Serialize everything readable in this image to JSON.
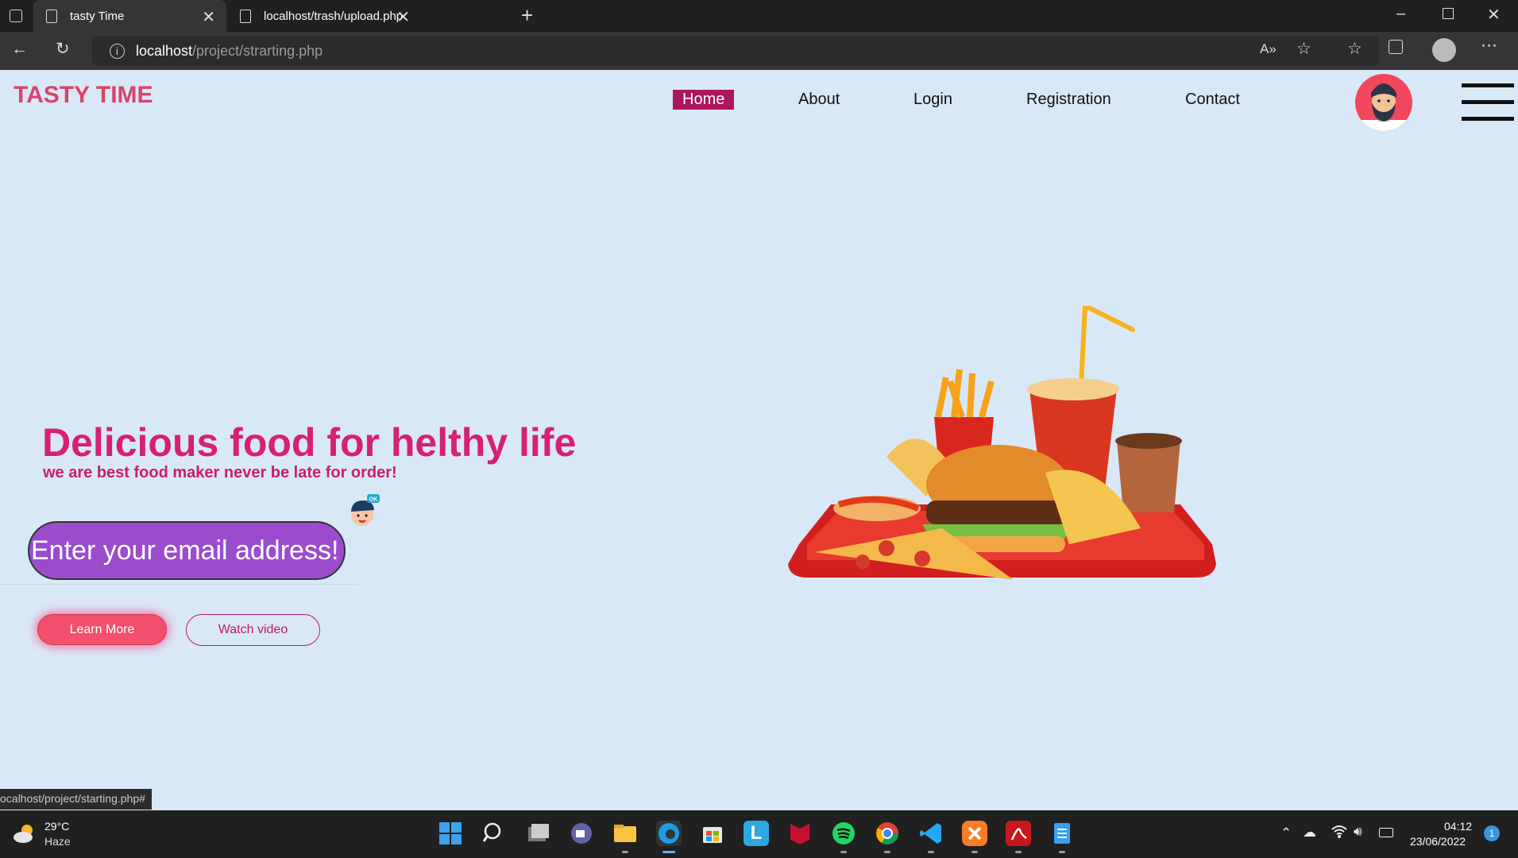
{
  "browser": {
    "tabs": [
      {
        "title": "tasty Time",
        "active": true
      },
      {
        "title": "localhost/trash/upload.php",
        "active": false
      }
    ],
    "url_host": "localhost",
    "url_path": "/project/strarting.php",
    "status_url": "ocalhost/project/starting.php#"
  },
  "site": {
    "logo": "TASTY TIME",
    "nav": [
      "Home",
      "About",
      "Login",
      "Registration",
      "Contact"
    ],
    "active_nav": "Home",
    "hero_title": "Delicious food for helthy life",
    "hero_subtitle": "we are best food maker never be late for order!",
    "email_placeholder": "Enter your email address!",
    "sticker_badge": "OK",
    "learn_more": "Learn More",
    "watch_video": "Watch video"
  },
  "taskbar": {
    "temperature": "29°C",
    "weather": "Haze",
    "time": "04:12",
    "date": "23/06/2022",
    "notification_count": "1",
    "app_icons": [
      "windows-start-icon",
      "search-icon",
      "task-view-icon",
      "teams-icon",
      "file-explorer-icon",
      "edge-icon",
      "store-icon",
      "l-app-icon",
      "mcafee-icon",
      "spotify-icon",
      "chrome-icon",
      "vscode-icon",
      "xampp-icon",
      "acrobat-icon",
      "notepad-icon"
    ]
  },
  "colors": {
    "page_bg": "#d9e8f7",
    "brand_pink": "#d71f74",
    "nav_active": "#ad155d",
    "email_bg": "#9b4ccc",
    "learn_button": "#f2506d"
  }
}
